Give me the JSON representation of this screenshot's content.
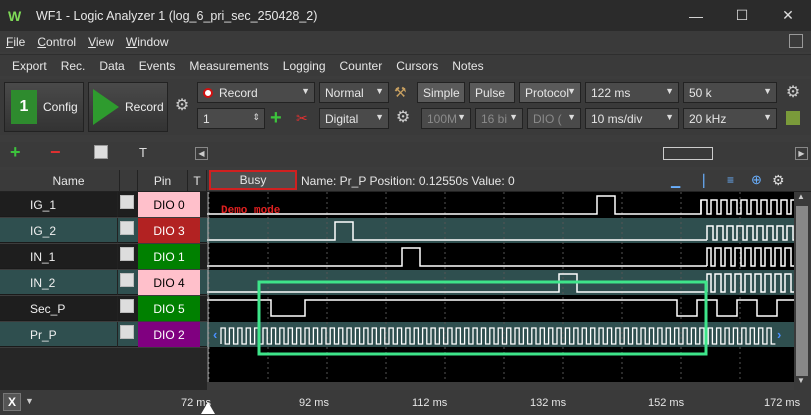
{
  "window": {
    "title": "WF1 - Logic Analyzer 1 (log_6_pri_sec_250428_2)",
    "minimize": "—",
    "maximize": "☐",
    "close": "✕"
  },
  "menu": [
    {
      "label": "File",
      "u": "F",
      "rest": "ile"
    },
    {
      "label": "Control",
      "u": "C",
      "rest": "ontrol"
    },
    {
      "label": "View",
      "u": "V",
      "rest": "iew"
    },
    {
      "label": "Window",
      "u": "W",
      "rest": "indow"
    }
  ],
  "toolmenu": [
    "Export",
    "Rec.",
    "Data",
    "Events",
    "Measurements",
    "Logging",
    "Counter",
    "Cursors",
    "Notes"
  ],
  "controls": {
    "config_label": "Config",
    "config_badge": "1",
    "record_label": "Record",
    "mode_select": "Record",
    "trigger_select": "Normal",
    "count_value": "1",
    "type_select": "Digital",
    "simple_btn": "Simple",
    "pulse_btn": "Pulse",
    "protocol_btn": "Protocol",
    "time_select": "122 ms",
    "samples_select": "50 k",
    "rate_select": "100M",
    "bits_select": "16 bi",
    "dio_select": "DIO (",
    "div_select": "10 ms/div",
    "freq_select": "20 kHz",
    "text_tool": "T"
  },
  "header": {
    "name_col": "Name",
    "pin_col": "Pin",
    "t_col": "T",
    "busy": "Busy",
    "info": "Name: Pr_P  Position: 0.12550s  Value: 0"
  },
  "demo_text": "Demo mode",
  "channels": [
    {
      "name": "IG_1",
      "pin": "DIO  0",
      "pin_bg": "#ffc0cb",
      "pin_fg": "#000000",
      "row_bg": "#000000"
    },
    {
      "name": "IG_2",
      "pin": "DIO  3",
      "pin_bg": "#b22222",
      "pin_fg": "#ffffff",
      "row_bg": "#2f4f4f"
    },
    {
      "name": "IN_1",
      "pin": "DIO  1",
      "pin_bg": "#008000",
      "pin_fg": "#ffffff",
      "row_bg": "#000000"
    },
    {
      "name": "IN_2",
      "pin": "DIO  4",
      "pin_bg": "#ffc0cb",
      "pin_fg": "#000000",
      "row_bg": "#2f4f4f"
    },
    {
      "name": "Sec_P",
      "pin": "DIO  5",
      "pin_bg": "#008000",
      "pin_fg": "#ffffff",
      "row_bg": "#000000"
    },
    {
      "name": "Pr_P",
      "pin": "DIO  2",
      "pin_bg": "#800080",
      "pin_fg": "#ffffff",
      "row_bg": "#2f4f4f"
    }
  ],
  "axis_ticks": [
    "72 ms",
    "92 ms",
    "112 ms",
    "132 ms",
    "152 ms",
    "172 ms"
  ],
  "axis_x_button": "X",
  "colors": {
    "highlight_box": "#3ee58a",
    "busy_border": "#d02020",
    "demo_text": "#e02020",
    "signal": "#ffffff"
  }
}
